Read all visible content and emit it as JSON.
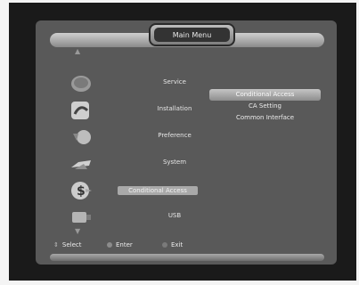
{
  "header": {
    "title": "Main Menu"
  },
  "menu": {
    "items": [
      {
        "label": "Service",
        "icon": "tv-icon"
      },
      {
        "label": "Installation",
        "icon": "satellite-dish-icon"
      },
      {
        "label": "Preference",
        "icon": "preference-icon"
      },
      {
        "label": "System",
        "icon": "system-icon"
      },
      {
        "label": "Conditional Access",
        "icon": "dollar-icon"
      },
      {
        "label": "USB",
        "icon": "usb-icon"
      }
    ],
    "selected_index": 4
  },
  "submenu": {
    "items": [
      {
        "label": "Conditional Access"
      },
      {
        "label": "CA Setting"
      },
      {
        "label": "Common Interface"
      }
    ],
    "highlighted_index": 0
  },
  "footer": {
    "select_label": "Select",
    "enter_label": "Enter",
    "exit_label": "Exit"
  },
  "colors": {
    "screen": "#595959",
    "highlight": "#a9a9a9"
  }
}
